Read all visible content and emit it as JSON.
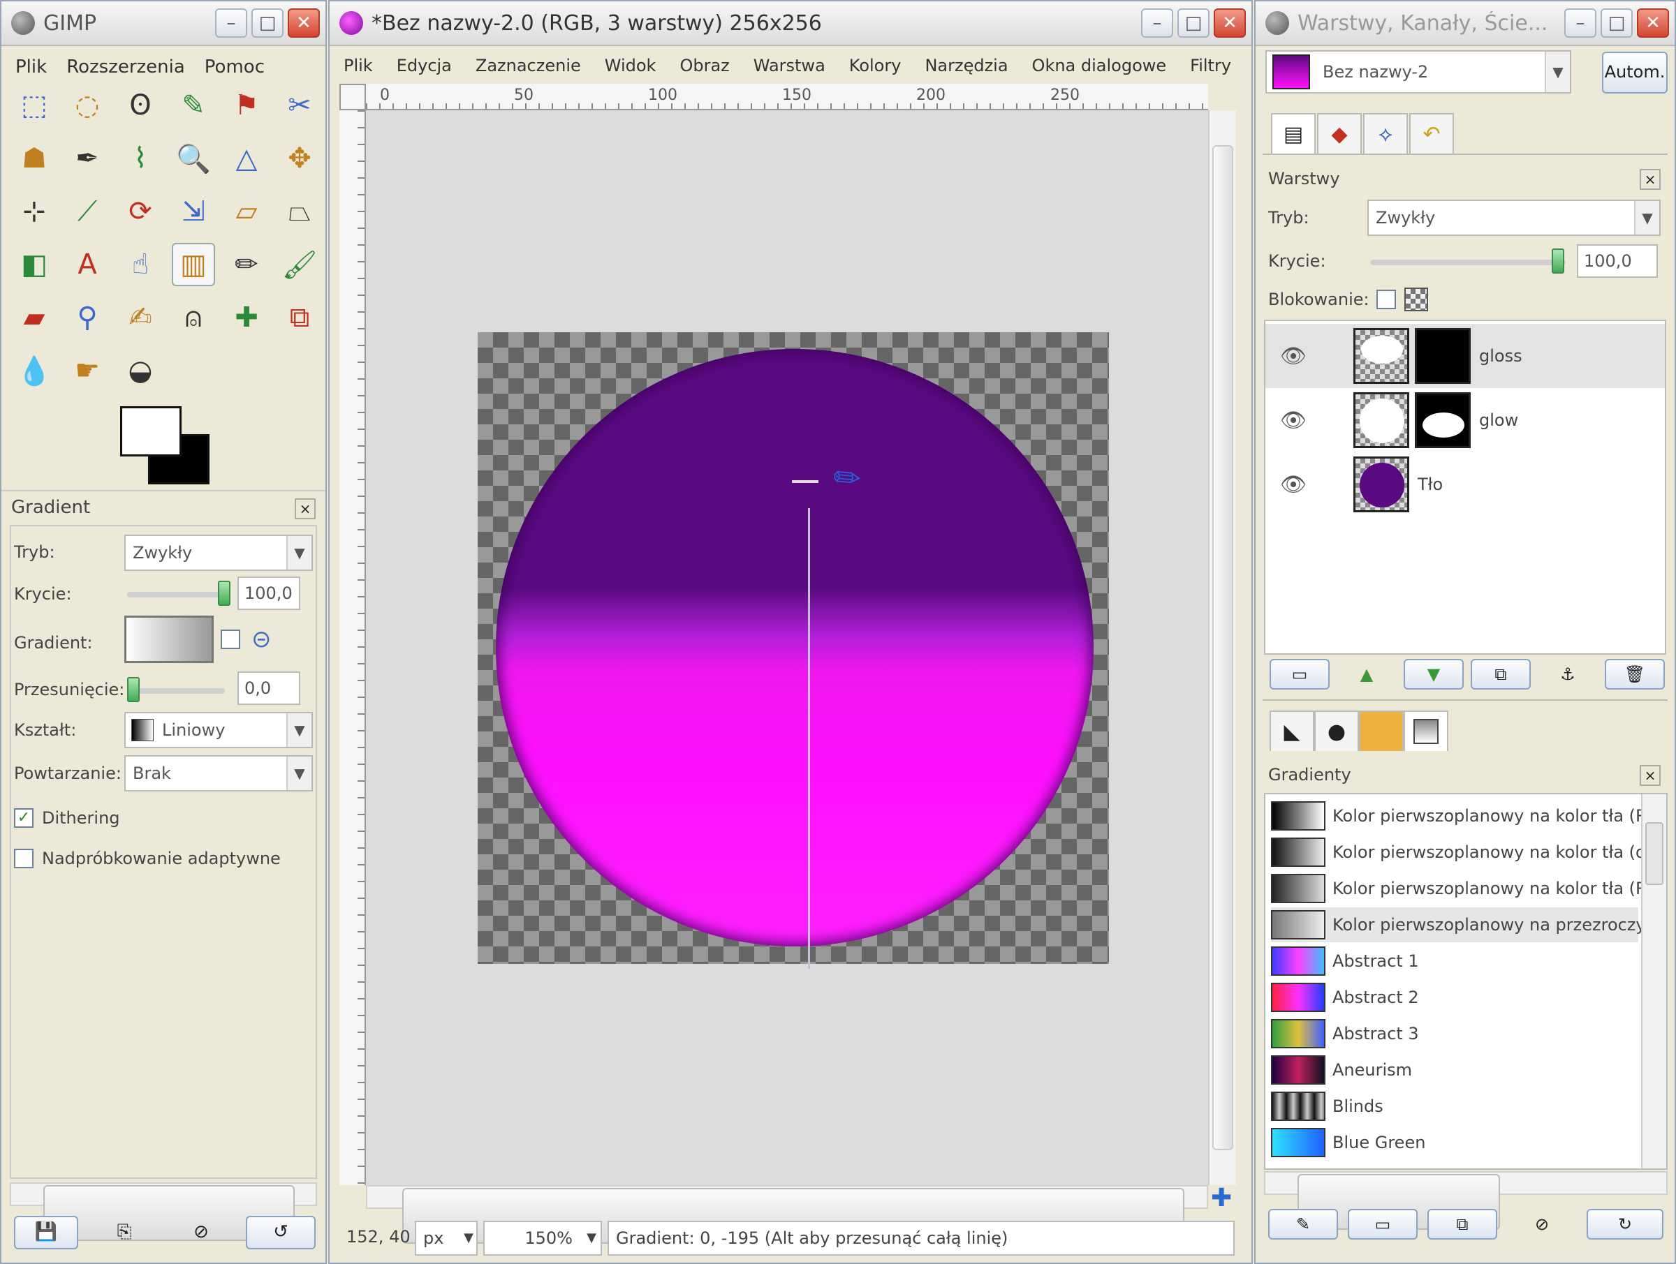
{
  "toolbox": {
    "title": "GIMP",
    "menu": [
      "Plik",
      "Rozszerzenia",
      "Pomoc"
    ],
    "tools": [
      {
        "name": "rect-select-icon",
        "glyph": "⬚"
      },
      {
        "name": "ellipse-select-icon",
        "glyph": "◌"
      },
      {
        "name": "free-select-icon",
        "glyph": "ʘ"
      },
      {
        "name": "fuzzy-select-icon",
        "glyph": "✎"
      },
      {
        "name": "select-by-color-icon",
        "glyph": "⚑"
      },
      {
        "name": "scissors-icon",
        "glyph": "✂"
      },
      {
        "name": "foreground-select-icon",
        "glyph": "☗"
      },
      {
        "name": "paths-icon",
        "glyph": "✒"
      },
      {
        "name": "color-picker-icon",
        "glyph": "⌇"
      },
      {
        "name": "zoom-icon",
        "glyph": "🔍"
      },
      {
        "name": "measure-icon",
        "glyph": "△"
      },
      {
        "name": "move-icon",
        "glyph": "✥"
      },
      {
        "name": "align-icon",
        "glyph": "⊹"
      },
      {
        "name": "crop-icon",
        "glyph": "⟋"
      },
      {
        "name": "rotate-icon",
        "glyph": "⟳"
      },
      {
        "name": "scale-icon",
        "glyph": "⇲"
      },
      {
        "name": "shear-icon",
        "glyph": "▱"
      },
      {
        "name": "perspective-icon",
        "glyph": "⏢"
      },
      {
        "name": "flip-icon",
        "glyph": "◧"
      },
      {
        "name": "text-icon",
        "glyph": "A"
      },
      {
        "name": "bucket-fill-icon",
        "glyph": "☝"
      },
      {
        "name": "blend-icon",
        "glyph": "▥"
      },
      {
        "name": "pencil-icon",
        "glyph": "✏"
      },
      {
        "name": "paintbrush-icon",
        "glyph": "🖌"
      },
      {
        "name": "eraser-icon",
        "glyph": "▰"
      },
      {
        "name": "airbrush-icon",
        "glyph": "⚲"
      },
      {
        "name": "ink-icon",
        "glyph": "✍"
      },
      {
        "name": "clone-icon",
        "glyph": "⍝"
      },
      {
        "name": "heal-icon",
        "glyph": "✚"
      },
      {
        "name": "perspective-clone-icon",
        "glyph": "⧉"
      },
      {
        "name": "blur-icon",
        "glyph": "💧"
      },
      {
        "name": "smudge-icon",
        "glyph": "☛"
      },
      {
        "name": "dodge-burn-icon",
        "glyph": "◒"
      }
    ],
    "selected_tool_index": 21,
    "options": {
      "title": "Gradient",
      "mode_label": "Tryb:",
      "mode_value": "Zwykły",
      "opacity_label": "Krycie:",
      "opacity_value": "100,0",
      "opacity_level": 1.0,
      "gradient_label": "Gradient:",
      "offset_label": "Przesunięcie:",
      "offset_value": "0,0",
      "offset_level": 0.0,
      "shape_label": "Kształt:",
      "shape_value": "Liniowy",
      "repeat_label": "Powtarzanie:",
      "repeat_value": "Brak",
      "dithering_label": "Dithering",
      "dithering_checked": true,
      "adaptive_label": "Nadpróbkowanie adaptywne",
      "adaptive_checked": false
    }
  },
  "image_window": {
    "title": "*Bez nazwy-2.0 (RGB, 3 warstwy) 256x256",
    "menu": [
      "Plik",
      "Edycja",
      "Zaznaczenie",
      "Widok",
      "Obraz",
      "Warstwa",
      "Kolory",
      "Narzędzia",
      "Okna dialogowe",
      "Filtry"
    ],
    "ruler_h": [
      "0",
      "50",
      "100",
      "150",
      "200",
      "250"
    ],
    "status": {
      "coords": "152, 40",
      "unit": "px",
      "zoom": "150%",
      "message": "Gradient: 0, -195 (Alt aby przesunąć całą linię)"
    }
  },
  "layers_dock": {
    "title": "Warstwy, Kanały, Ście...",
    "image_name": "Bez nazwy-2",
    "auto_label": "Autom.",
    "section_title": "Warstwy",
    "mode_label": "Tryb:",
    "mode_value": "Zwykły",
    "opacity_label": "Krycie:",
    "opacity_value": "100,0",
    "lock_label": "Blokowanie:",
    "layers": [
      {
        "name": "gloss",
        "selected": true
      },
      {
        "name": "glow",
        "selected": false
      },
      {
        "name": "Tło",
        "selected": false
      }
    ],
    "gradients_title": "Gradienty",
    "gradients": [
      {
        "name": "Kolor pierwszoplanowy na kolor tła (R",
        "swatch": "linear-gradient(to right,#000,#fff)"
      },
      {
        "name": "Kolor pierwszoplanowy na kolor tła (od",
        "swatch": "linear-gradient(to right,#111,#eee)"
      },
      {
        "name": "Kolor pierwszoplanowy na kolor tła (R",
        "swatch": "linear-gradient(to right,#222,#ddd)"
      },
      {
        "name": "Kolor pierwszoplanowy na przezroczy",
        "swatch": "linear-gradient(to right,#777,#eee)"
      },
      {
        "name": "Abstract 1",
        "swatch": "linear-gradient(to right,#3b3bff,#ff40ff,#40c0ff)"
      },
      {
        "name": "Abstract 2",
        "swatch": "linear-gradient(to right,#ff2040,#ff30ff,#2040ff)"
      },
      {
        "name": "Abstract 3",
        "swatch": "linear-gradient(to right,#30a040,#e0c040,#4060ff)"
      },
      {
        "name": "Aneurism",
        "swatch": "linear-gradient(to right,#200040,#c02060,#101020)"
      },
      {
        "name": "Blinds",
        "swatch": "repeating-linear-gradient(to right,#111 0,#ccc 10px,#111 20px)"
      },
      {
        "name": "Blue Green",
        "swatch": "linear-gradient(to right,#30e0ff,#2060ff)"
      }
    ],
    "selected_gradient_index": 3
  }
}
